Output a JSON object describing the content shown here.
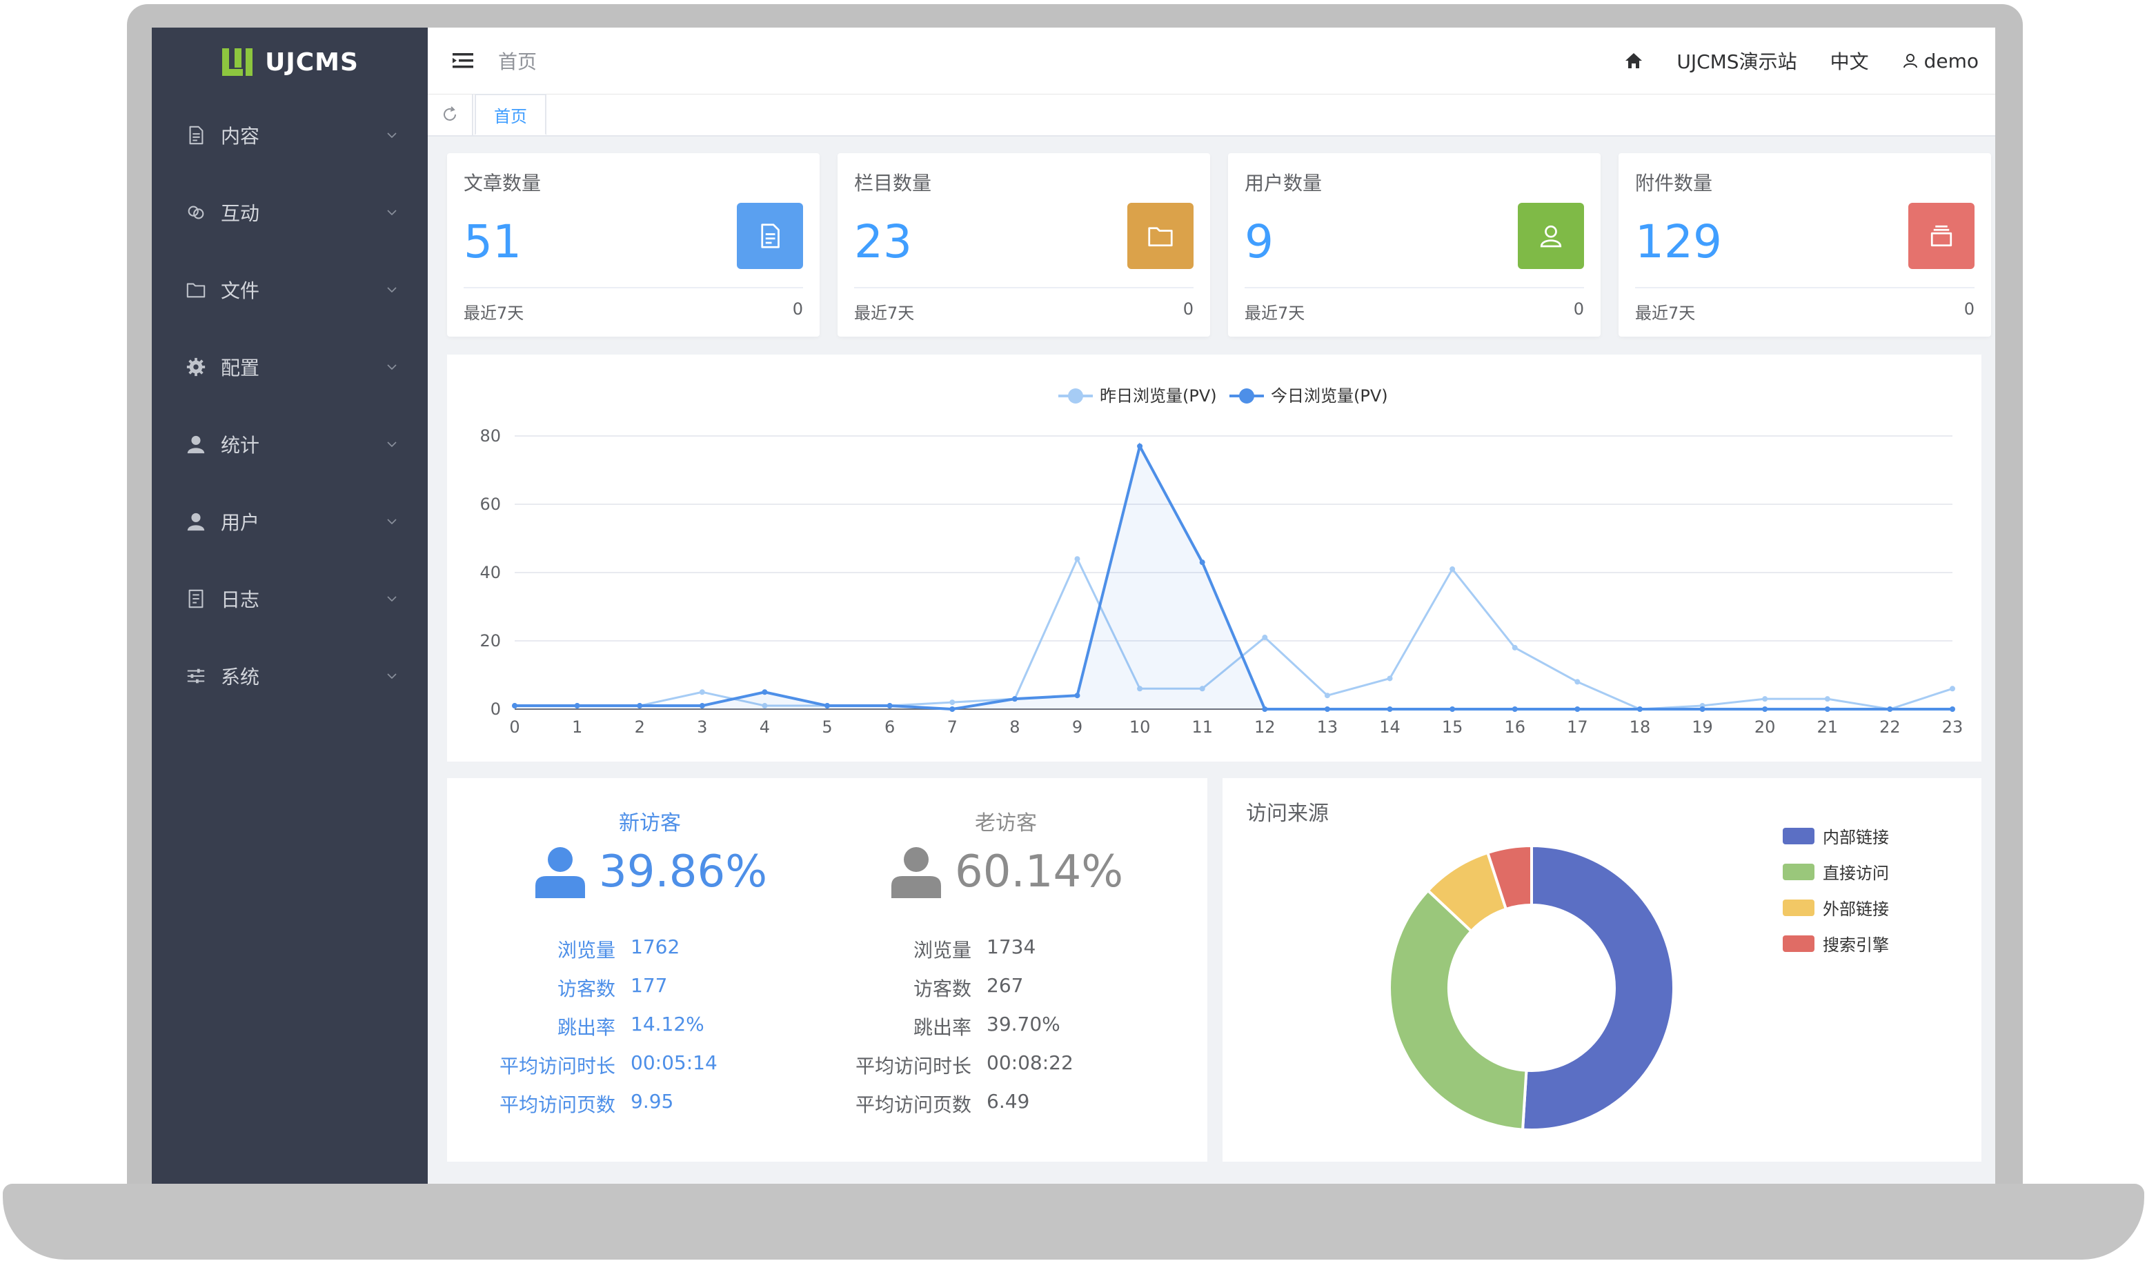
{
  "app": {
    "logo_text": "UJCMS"
  },
  "sidebar": {
    "items": [
      {
        "label": "内容",
        "icon": "document-icon"
      },
      {
        "label": "互动",
        "icon": "chat-icon"
      },
      {
        "label": "文件",
        "icon": "folder-icon"
      },
      {
        "label": "配置",
        "icon": "gear-icon"
      },
      {
        "label": "统计",
        "icon": "user-icon"
      },
      {
        "label": "用户",
        "icon": "user-icon"
      },
      {
        "label": "日志",
        "icon": "log-icon"
      },
      {
        "label": "系统",
        "icon": "sliders-icon"
      }
    ]
  },
  "header": {
    "breadcrumb": "首页",
    "site_name": "UJCMS演示站",
    "language": "中文",
    "username": "demo"
  },
  "tabs": {
    "home": "首页"
  },
  "stats": [
    {
      "title": "文章数量",
      "value": "51",
      "footer_label": "最近7天",
      "footer_value": "0",
      "color": "#5aa0f0",
      "icon": "document-icon"
    },
    {
      "title": "栏目数量",
      "value": "23",
      "footer_label": "最近7天",
      "footer_value": "0",
      "color": "#dba24a",
      "icon": "folder-icon"
    },
    {
      "title": "用户数量",
      "value": "9",
      "footer_label": "最近7天",
      "footer_value": "0",
      "color": "#7fba47",
      "icon": "user-icon"
    },
    {
      "title": "附件数量",
      "value": "129",
      "footer_label": "最近7天",
      "footer_value": "0",
      "color": "#e5726d",
      "icon": "stack-icon"
    }
  ],
  "chart_data": {
    "type": "line",
    "x": [
      0,
      1,
      2,
      3,
      4,
      5,
      6,
      7,
      8,
      9,
      10,
      11,
      12,
      13,
      14,
      15,
      16,
      17,
      18,
      19,
      20,
      21,
      22,
      23
    ],
    "ylim": [
      0,
      80
    ],
    "yticks": [
      0,
      20,
      40,
      60,
      80
    ],
    "legend_position": "top-center",
    "grid": true,
    "series": [
      {
        "name": "昨日浏览量(PV)",
        "color": "#a6ccf5",
        "values": [
          1,
          1,
          1,
          5,
          1,
          1,
          1,
          2,
          3,
          44,
          6,
          6,
          21,
          4,
          9,
          41,
          18,
          8,
          0,
          1,
          3,
          3,
          0,
          6
        ]
      },
      {
        "name": "今日浏览量(PV)",
        "color": "#4d8fe8",
        "values": [
          1,
          1,
          1,
          1,
          5,
          1,
          1,
          0,
          3,
          4,
          77,
          43,
          0,
          0,
          0,
          0,
          0,
          0,
          0,
          0,
          0,
          0,
          0,
          0
        ]
      }
    ]
  },
  "visitors": {
    "new": {
      "title": "新访客",
      "percent": "39.86%",
      "color": "#4d8fe8",
      "rows": [
        {
          "label": "浏览量",
          "value": "1762"
        },
        {
          "label": "访客数",
          "value": "177"
        },
        {
          "label": "跳出率",
          "value": "14.12%"
        },
        {
          "label": "平均访问时长",
          "value": "00:05:14"
        },
        {
          "label": "平均访问页数",
          "value": "9.95"
        }
      ]
    },
    "old": {
      "title": "老访客",
      "percent": "60.14%",
      "color": "#8c8c8c",
      "rows": [
        {
          "label": "浏览量",
          "value": "1734"
        },
        {
          "label": "访客数",
          "value": "267"
        },
        {
          "label": "跳出率",
          "value": "39.70%"
        },
        {
          "label": "平均访问时长",
          "value": "00:08:22"
        },
        {
          "label": "平均访问页数",
          "value": "6.49"
        }
      ]
    }
  },
  "source": {
    "title": "访问来源",
    "chart_data": {
      "type": "pie",
      "donut": true,
      "legend_position": "top-right",
      "slices": [
        {
          "name": "内部链接",
          "value": 51,
          "color": "#5b6fc4"
        },
        {
          "name": "直接访问",
          "value": 36,
          "color": "#9ac77b"
        },
        {
          "name": "外部链接",
          "value": 8,
          "color": "#f2c865"
        },
        {
          "name": "搜索引擎",
          "value": 5,
          "color": "#e06c65"
        }
      ]
    }
  }
}
